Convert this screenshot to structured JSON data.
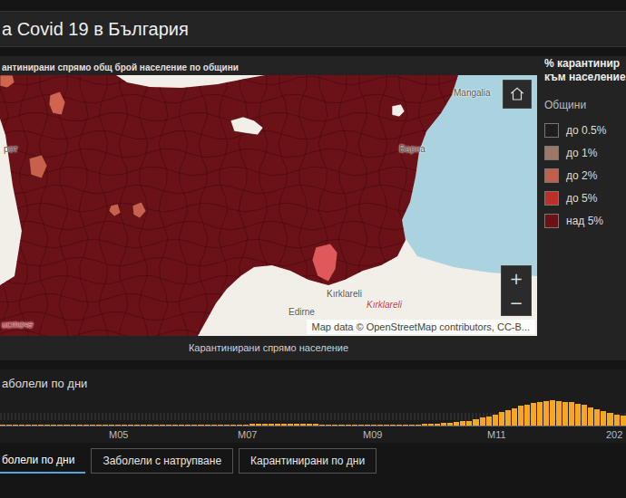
{
  "header": {
    "title": "а Covid 19 в България"
  },
  "map_panel": {
    "title": "антинирани спрямо общ брой население по общини",
    "caption": "Карантинирани спрямо население"
  },
  "legend": {
    "title_lines": [
      "% карантинир",
      "към население"
    ],
    "subtitle": "Общини",
    "items": [
      {
        "label": "до 0.5%",
        "color": "#1e1e1e"
      },
      {
        "label": "до 1%",
        "color": "#9c7868"
      },
      {
        "label": "до 2%",
        "color": "#c0604c"
      },
      {
        "label": "до 5%",
        "color": "#c02e28"
      },
      {
        "label": "над 5%",
        "color": "#6b1219"
      }
    ]
  },
  "map": {
    "regions": [
      {
        "color": "#d0644f"
      },
      {
        "color": "#d0644f"
      },
      {
        "color": "#c8604e"
      },
      {
        "color": "#c8604e"
      },
      {
        "color": "#c8604e"
      },
      {
        "color": "#e0595a"
      },
      {
        "color": "#f2efe9"
      },
      {
        "color": "#f2efe9"
      }
    ],
    "labels": [
      {
        "text": "Mangalia",
        "kind": "city"
      },
      {
        "text": "Варна",
        "kind": "city"
      },
      {
        "text": "Kırklareli",
        "kind": "city"
      },
      {
        "text": "Edirne",
        "kind": "city"
      },
      {
        "text": "Kırklareli",
        "kind": "province"
      },
      {
        "text": "рот",
        "kind": "city"
      },
      {
        "text": "источе",
        "kind": "province"
      }
    ],
    "attribution": "Map data © OpenStreetMap contributors, CC-B...",
    "zoom_in": "+",
    "zoom_out": "−"
  },
  "chart": {
    "title": "аболели по дни",
    "ticks": [
      "M05",
      "M07",
      "M09",
      "M11",
      "202"
    ],
    "series": [
      {
        "values": [
          5,
          10,
          20,
          30,
          40,
          50,
          45,
          40,
          35,
          40,
          45,
          40,
          35,
          30,
          30,
          25,
          25,
          30,
          35,
          40,
          40,
          35,
          30,
          25,
          30,
          35,
          40,
          50,
          60,
          80,
          100,
          110,
          120,
          130,
          150,
          160,
          170,
          180,
          190,
          200,
          220,
          230,
          240,
          250,
          250,
          240,
          230,
          220,
          210,
          200,
          190,
          180,
          170,
          160,
          150,
          140,
          130,
          120,
          110,
          100,
          100,
          110,
          120,
          130,
          150,
          170,
          200,
          250,
          300,
          350,
          400,
          500,
          600,
          700,
          900,
          1100,
          1300,
          1600,
          1900,
          2200,
          2500,
          2800,
          3000,
          3200,
          3400,
          3500,
          3600,
          3500,
          3400,
          3300,
          3100,
          2900,
          2600,
          2300,
          2000,
          1800,
          1600,
          1400
        ]
      }
    ]
  },
  "tabs": [
    {
      "label": "болели по дни",
      "selected": true
    },
    {
      "label": "Заболели с натрупване",
      "selected": false
    },
    {
      "label": "Карантинирани по дни",
      "selected": false
    }
  ]
}
